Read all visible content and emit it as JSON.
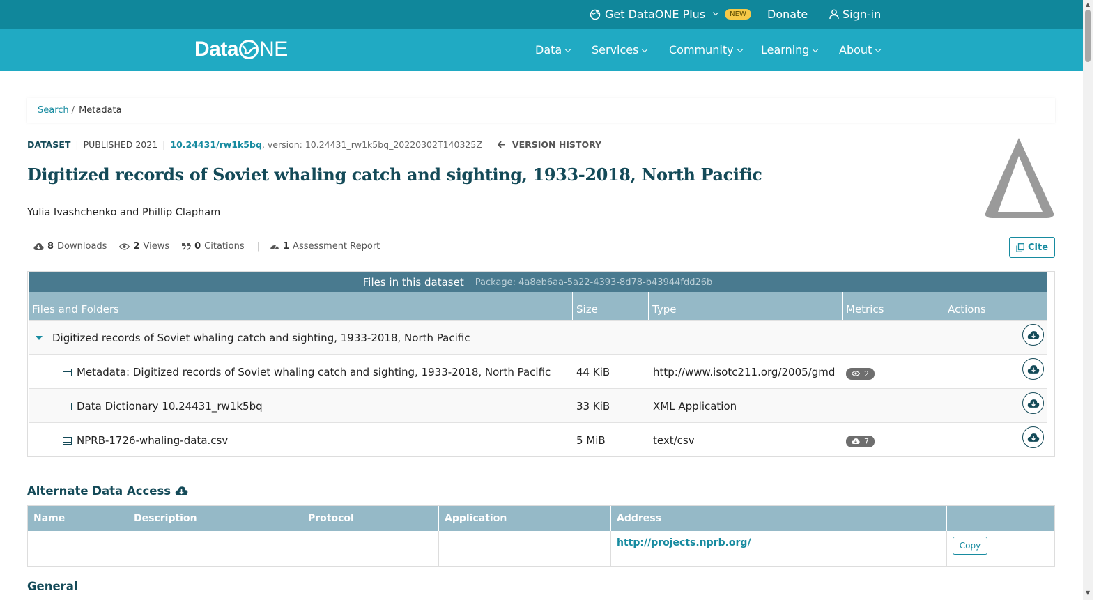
{
  "topbar": {
    "plus_label": "Get DataONE Plus",
    "new_badge": "NEW",
    "donate": "Donate",
    "signin": "Sign-in"
  },
  "navbar": {
    "logo_left": "Data",
    "logo_right": "NE",
    "items": [
      "Data",
      "Services",
      "Community",
      "Learning",
      "About"
    ]
  },
  "breadcrumb": {
    "search": "Search",
    "sep": "/",
    "current": "Metadata"
  },
  "dataset": {
    "type": "DATASET",
    "published": "PUBLISHED 2021",
    "doi": "10.24431/rw1k5bq",
    "version": ", version: 10.24431_rw1k5bq_20220302T140325Z",
    "version_history": "VERSION HISTORY",
    "title": "Digitized records of Soviet whaling catch and sighting, 1933-2018, North Pacific",
    "authors": "Yulia Ivashchenko and Phillip Clapham"
  },
  "stats": {
    "downloads_count": "8",
    "downloads_label": "Downloads",
    "views_count": "2",
    "views_label": "Views",
    "citations_count": "0",
    "citations_label": "Citations",
    "assessment_count": "1",
    "assessment_label": "Assessment Report",
    "cite": "Cite"
  },
  "files": {
    "caption": "Files in this dataset",
    "package": "Package: 4a8eb6aa-5a22-4393-8d78-b43944fdd26b",
    "headers": [
      "Files and Folders",
      "Size",
      "Type",
      "Metrics",
      "Actions"
    ],
    "folder": "Digitized records of Soviet whaling catch and sighting, 1933-2018, North Pacific",
    "rows": [
      {
        "name": "Metadata: Digitized records of Soviet whaling catch and sighting, 1933-2018, North Pacific",
        "size": "44 KiB",
        "type": "http://www.isotc211.org/2005/gmd",
        "metric": "2"
      },
      {
        "name": "Data Dictionary 10.24431_rw1k5bq",
        "size": "33 KiB",
        "type": "XML Application",
        "metric": ""
      },
      {
        "name": "NPRB-1726-whaling-data.csv",
        "size": "5 MiB",
        "type": "text/csv",
        "metric": "7"
      }
    ]
  },
  "alternate": {
    "title": "Alternate Data Access",
    "headers": [
      "Name",
      "Description",
      "Protocol",
      "Application",
      "Address",
      ""
    ],
    "address": "http://projects.nprb.org/",
    "copy": "Copy"
  },
  "general": "General",
  "colors": {
    "topbar": "#10879b",
    "navbar": "#20aac3",
    "dark_teal": "#144a58",
    "link": "#178ba0",
    "table_caption": "#497a8f",
    "table_head": "#95b9c7",
    "new_badge": "#f7c948"
  }
}
